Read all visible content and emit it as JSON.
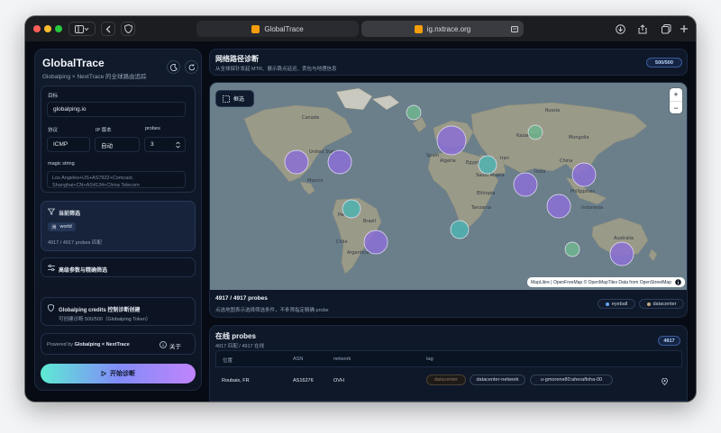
{
  "browser": {
    "tab_title": "GlobalTrace",
    "url": "ig.nxtrace.org",
    "icons": [
      "sidebar-icon",
      "back-icon",
      "shield-icon",
      "reader-icon",
      "download-icon",
      "share-icon",
      "tabs-icon",
      "plus-icon"
    ]
  },
  "sidebar": {
    "title": "GlobalTrace",
    "subtitle": "Globalping × NextTrace 的全球路由追踪",
    "target_label": "目标",
    "target_value": "globalping.io",
    "protocol_label": "协议",
    "protocol_value": "ICMP",
    "ip_label": "IP 版本",
    "ip_value": "自动",
    "probes_label": "probes",
    "probes_value": "3",
    "magic_label": "magic string",
    "magic_value": "Los Angeles+US+AS7922+Comcast, Shanghai+CN+AS4134+China Telecom",
    "filter_title": "当前筛选",
    "filter_chip_key": "洲",
    "filter_chip_value": "world",
    "filter_count": "4917 / 4917 probes 匹配",
    "advanced_label": "高级参数与精确筛选",
    "credits_title": "Globalping credits 控制诊断创建",
    "credits_sub": "可创建诊断 500/500（Globalping Token）",
    "powered_prefix": "Powered by",
    "powered_brand": "Globalping × NextTrace",
    "about_label": "关于",
    "start_label": "开始诊断"
  },
  "header": {
    "title": "网络路径诊断",
    "subtitle": "从全球探针发起 MTR、展示跳点延迟、丢包与地理信息",
    "quota_badge": "500/500"
  },
  "map": {
    "select_label": "框选",
    "zoom_in": "+",
    "zoom_out": "−",
    "attribution": "MapLibre | OpenFreeMap © OpenMapTiles Data from OpenStreetMap",
    "labels": [
      "Canada",
      "Russia",
      "United States",
      "Mexico",
      "Brazil",
      "Peru",
      "Argentina",
      "Chile",
      "India",
      "China",
      "Australia",
      "Algeria",
      "Spain",
      "Saudi Arabia",
      "Ethiopia",
      "Tanzania",
      "Egypt",
      "Philippines",
      "Mongolia",
      "Iran",
      "Kazakhstan",
      "Indonesia"
    ],
    "footer_count": "4917 / 4917 probes",
    "footer_hint": "点选地图表示选择筛选条件，不条筛指定精确 probe",
    "legend": [
      {
        "label": "eyeball",
        "color": "#60a5fa"
      },
      {
        "label": "datacenter",
        "color": "#c4a882"
      }
    ],
    "colors": {
      "cluster_purple": "#8b6fd6",
      "cluster_teal": "#4fb3b0",
      "cluster_green": "#6fb58d"
    }
  },
  "probes": {
    "title": "在线 probes",
    "summary": "4917 匹配 / 4917 在线",
    "count_badge": "4917",
    "columns": [
      "位置",
      "ASN",
      "network",
      "tag"
    ],
    "rows": [
      {
        "location": "Roubaix, FR",
        "asn": "AS16276",
        "network": "OVH",
        "tags": [
          "datacenter",
          "datacenter-network",
          "u-gmorene80:aherafloha-00"
        ]
      }
    ]
  }
}
